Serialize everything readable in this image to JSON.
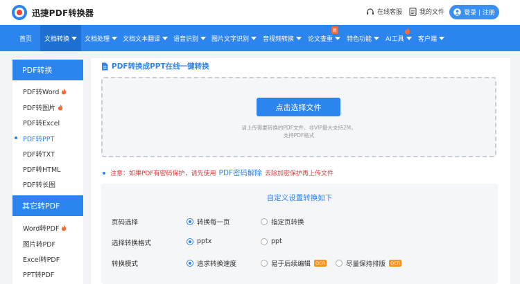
{
  "header": {
    "brand": "迅捷PDF转换器",
    "service_label": "在线客服",
    "files_label": "我的文件",
    "login_label": "登录 | 注册"
  },
  "nav": {
    "items": [
      {
        "label": "首页",
        "caret": false
      },
      {
        "label": "文档转换",
        "caret": true,
        "active": true
      },
      {
        "label": "文档处理",
        "caret": true
      },
      {
        "label": "文档文本翻译",
        "caret": true
      },
      {
        "label": "语音识别",
        "caret": true
      },
      {
        "label": "图片文字识别",
        "caret": true
      },
      {
        "label": "音视频转换",
        "caret": true
      },
      {
        "label": "论文查重",
        "caret": true,
        "badge": "新"
      },
      {
        "label": "特色功能",
        "caret": true
      },
      {
        "label": "AI工具",
        "caret": true,
        "flame": true
      },
      {
        "label": "客户端",
        "caret": true
      }
    ]
  },
  "sidebar": {
    "group1_title": "PDF转换",
    "group1_items": [
      {
        "label": "PDF转Word",
        "hot": true
      },
      {
        "label": "PDF转图片",
        "hot": true
      },
      {
        "label": "PDF转Excel"
      },
      {
        "label": "PDF转PPT",
        "active": true
      },
      {
        "label": "PDF转TXT"
      },
      {
        "label": "PDF转HTML"
      },
      {
        "label": "PDF转长图"
      }
    ],
    "group2_title": "其它转PDF",
    "group2_items": [
      {
        "label": "Word转PDF",
        "hot": true
      },
      {
        "label": "图片转PDF"
      },
      {
        "label": "Excel转PDF"
      },
      {
        "label": "PPT转PDF"
      }
    ]
  },
  "main": {
    "title": "PDF转换成PPT在线一键转换",
    "choose_button": "点击选择文件",
    "hint_line1": "请上传需要转换的PDF文件，非VIP最大支持2M，",
    "hint_line2": "支持PDF格式",
    "notice_prefix": "注意：如果PDF有密码保护，请先使用",
    "notice_link": "PDF密码解除",
    "notice_suffix": "去除加密保护再上传文件"
  },
  "settings": {
    "title": "自定义设置转换如下",
    "rows": [
      {
        "label": "页码选择",
        "options": [
          {
            "label": "转换每一页",
            "selected": true
          },
          {
            "label": "指定页转换",
            "selected": false
          }
        ]
      },
      {
        "label": "选择转换格式",
        "options": [
          {
            "label": "pptx",
            "selected": true
          },
          {
            "label": "ppt",
            "selected": false
          }
        ]
      },
      {
        "label": "转换模式",
        "options": [
          {
            "label": "追求转换速度",
            "selected": true
          },
          {
            "label": "易于后续编辑",
            "selected": false,
            "badge": "OCR"
          },
          {
            "label": "尽量保持排版",
            "selected": false,
            "badge": "OCR"
          }
        ]
      }
    ]
  },
  "colors": {
    "primary": "#2c84ef",
    "active_nav": "#1e6fd2",
    "notice": "#e03a3a",
    "ocr_badge": "#f7931e",
    "hot": "#f06b3a"
  }
}
